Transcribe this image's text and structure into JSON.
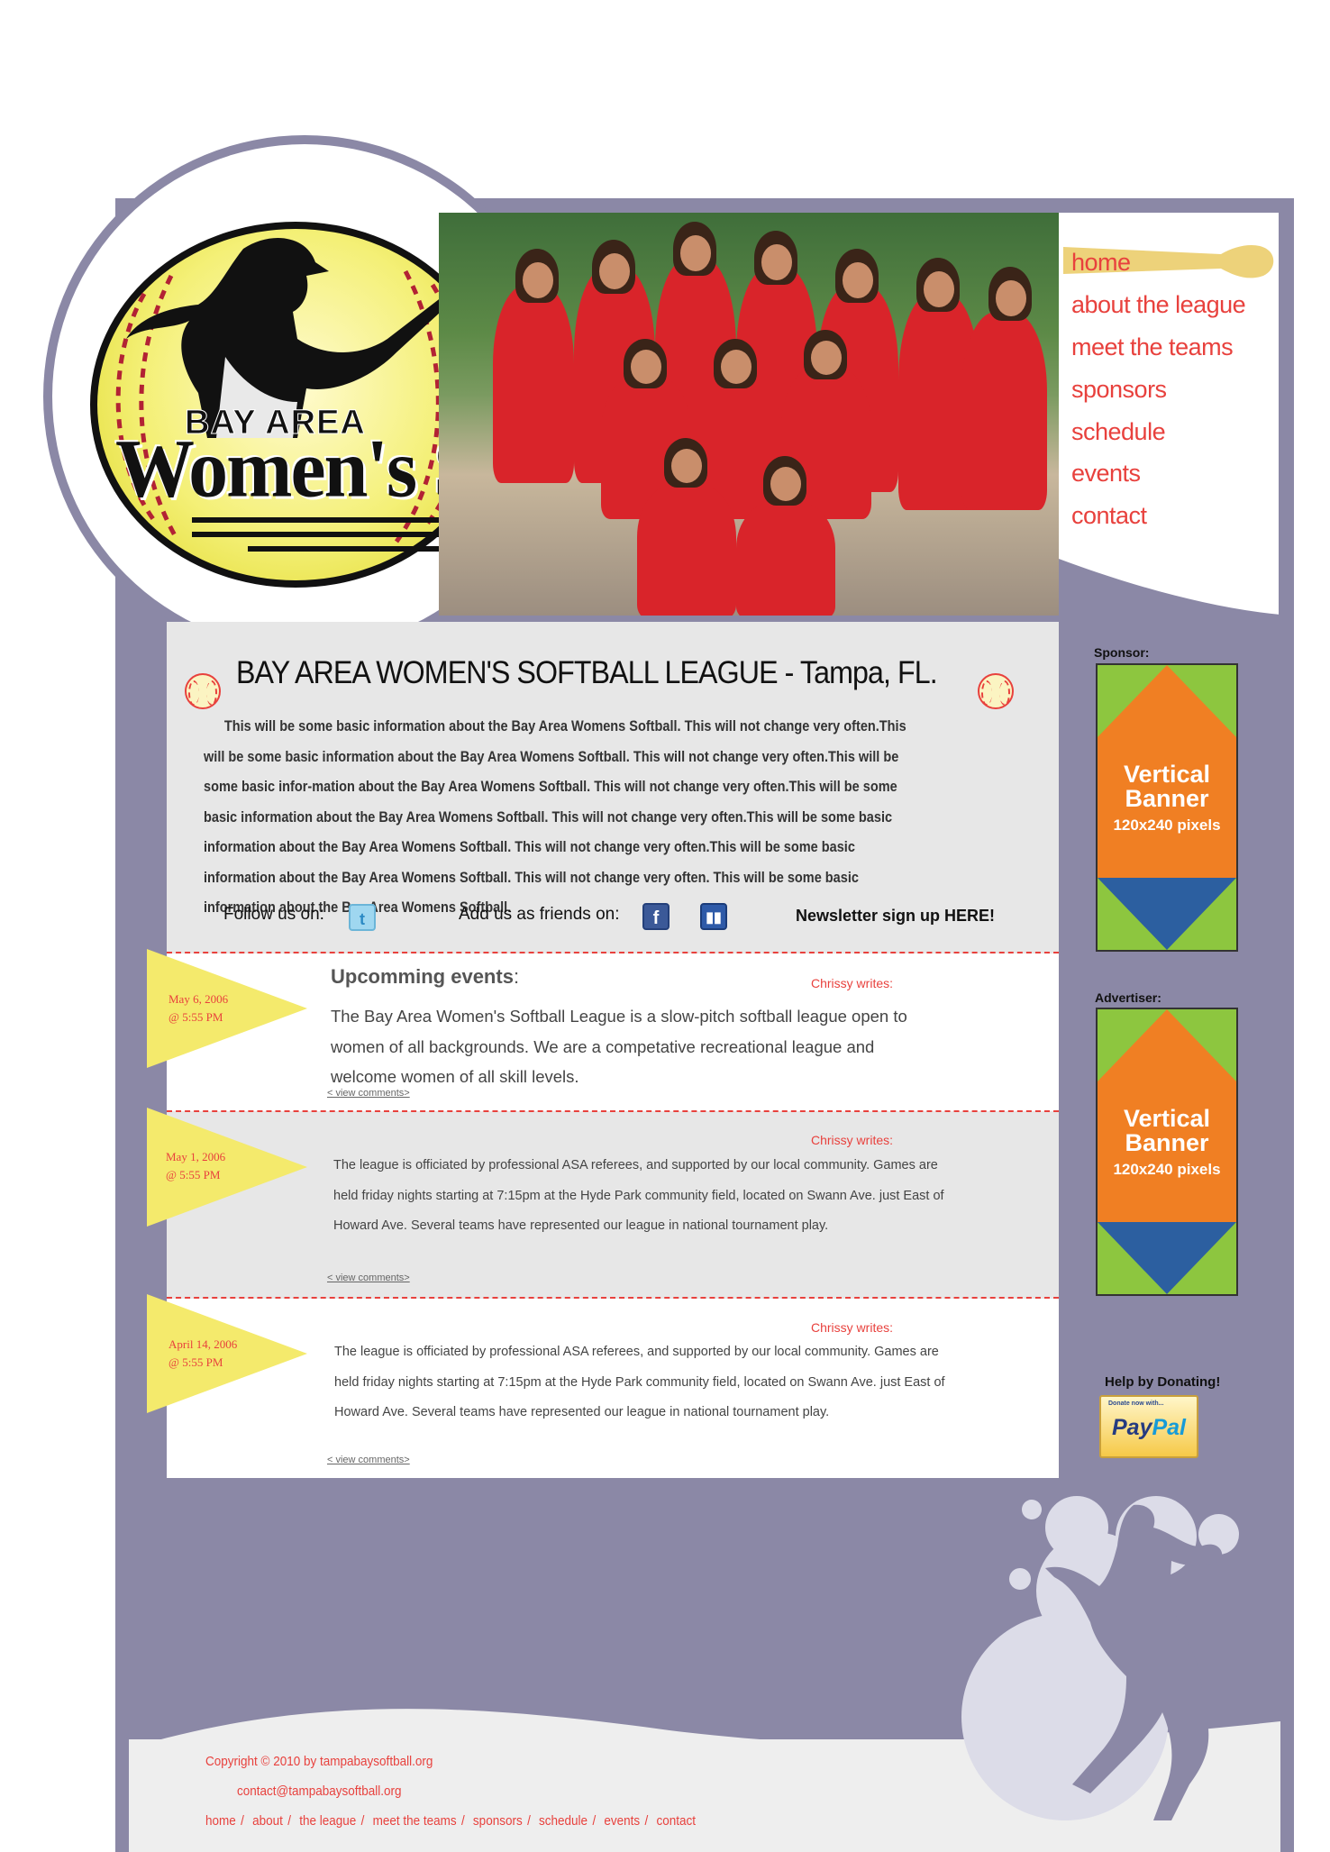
{
  "nav": {
    "items": [
      {
        "label": "home",
        "active": true
      },
      {
        "label": "about the league"
      },
      {
        "label": "meet the teams"
      },
      {
        "label": "sponsors"
      },
      {
        "label": "schedule"
      },
      {
        "label": "events"
      },
      {
        "label": "contact"
      }
    ]
  },
  "logo": {
    "line1": "BAY AREA",
    "line2": "Women's Softball"
  },
  "main": {
    "title": "BAY AREA  WOMEN'S  SOFTBALL LEAGUE - Tampa, FL.",
    "intro": "This will be some basic information about the Bay Area Womens Softball.  This will not change very often.This will be some basic information about the Bay Area Womens Softball.  This will not change very often.This will be some basic infor-mation about the Bay Area Womens Softball.  This will not change very often.This will be some basic information about the Bay Area Womens Softball.  This will not change very often.This will be some basic information about the Bay Area Womens Softball.  This will not change very often.This will be some basic information about the Bay Area Womens Softball.  This will not change very often. This will be some basic information about the Bay Area Womens Softball.",
    "follow_label": "Follow us on:",
    "friends_label": "Add us as friends on:",
    "newsletter": "Newsletter sign up HERE!"
  },
  "posts": [
    {
      "date": "May 6, 2006",
      "time": "@ 5:55 PM",
      "heading": "Upcomming events",
      "heading_suffix": ":",
      "author": "Chrissy   writes:",
      "text": "The Bay Area Women's Softball League is a slow-pitch softball league open to women of all backgrounds. We are a competative recreational league and welcome women of all skill levels.",
      "comments": "< view comments>"
    },
    {
      "date": "May 1, 2006",
      "time": "@ 5:55 PM",
      "author": "Chrissy   writes:",
      "text": "The league is officiated by professional ASA referees, and supported by our local community. Games are held friday nights starting at 7:15pm at the Hyde Park community field, located on Swann Ave. just East of Howard Ave. Several teams have represented our league in national tournament play.",
      "comments": "< view comments>"
    },
    {
      "date": "April 14, 2006",
      "time": "@ 5:55 PM",
      "author": "Chrissy   writes:",
      "text": "The league is officiated by professional ASA referees, and supported by our local community. Games are held friday nights starting at 7:15pm at the Hyde Park community field, located on Swann Ave. just East of Howard Ave. Several teams have represented our league in national tournament play.",
      "comments": "< view comments>"
    }
  ],
  "sidebar": {
    "sponsor_label": "Sponsor:",
    "advertiser_label": "Advertiser:",
    "banner_line1": "Vertical",
    "banner_line2": "Banner",
    "banner_size": "120x240 pixels",
    "donate_label": "Help by Donating!",
    "paypal_small": "Donate now with...",
    "paypal_pay": "Pay",
    "paypal_pal": "Pal"
  },
  "footer": {
    "copyright": "Copyright © 2010 by tampabaysoftball.org",
    "email": "contact@tampabaysoftball.org",
    "links": [
      "home",
      "about",
      "the league",
      "meet the teams",
      "sponsors",
      "schedule",
      "events",
      "contact"
    ]
  },
  "colors": {
    "frame": "#8b88a6",
    "accent": "#e8413d",
    "pennant": "#f4ea6c",
    "banner_orange": "#f07f23",
    "banner_green": "#8dc63f",
    "banner_blue": "#2c5fa0"
  }
}
